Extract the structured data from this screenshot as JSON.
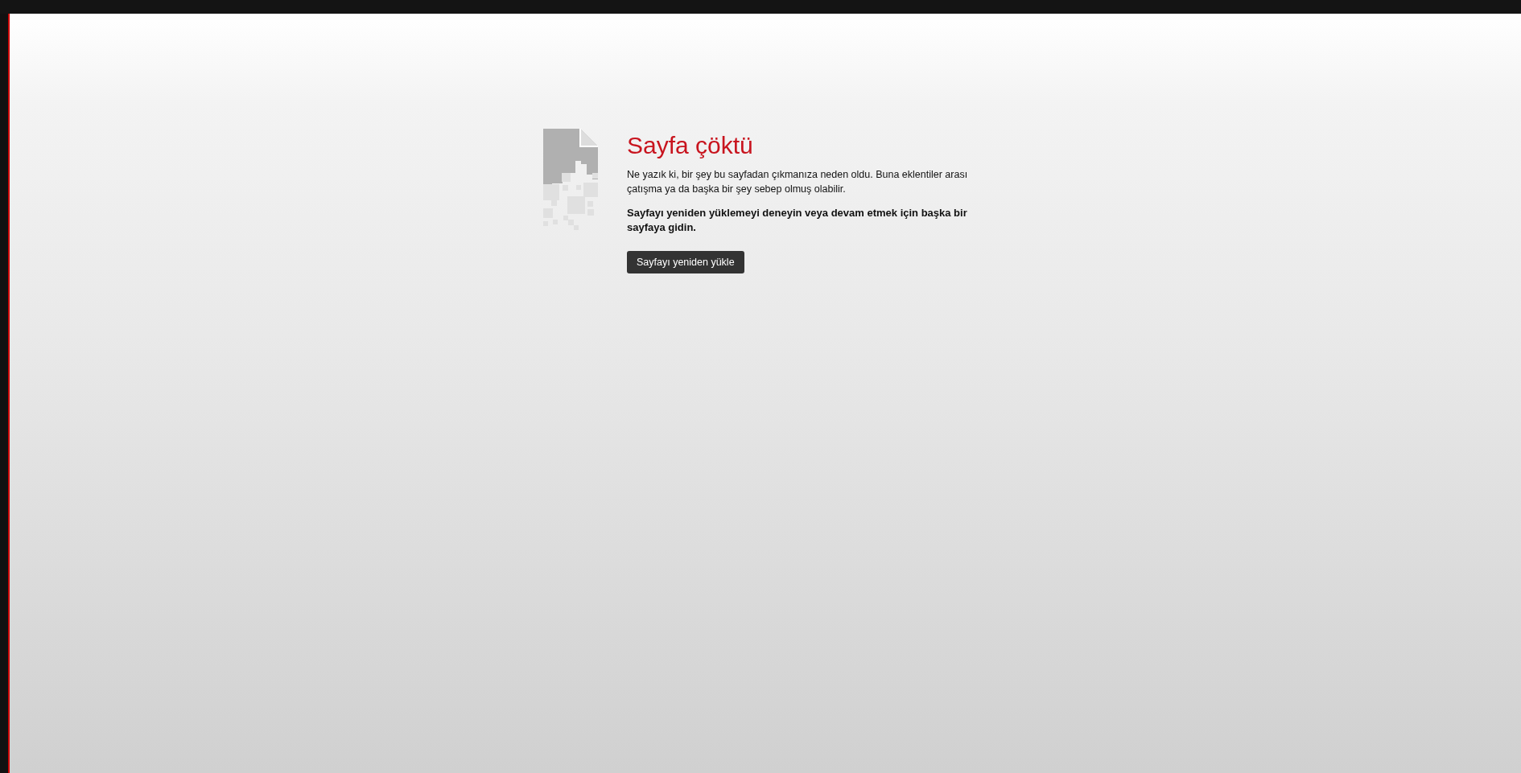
{
  "crash_page": {
    "title": "Sayfa çöktü",
    "message": "Ne yazık ki, bir şey bu sayfadan çıkmanıza neden oldu. Buna eklentiler arası çatışma ya da başka bir şey sebep olmuş olabilir.",
    "advice": "Sayfayı yeniden yüklemeyi deneyin veya devam etmek için başka bir sayfaya gidin.",
    "button": "Sayfayı yeniden yükle"
  }
}
